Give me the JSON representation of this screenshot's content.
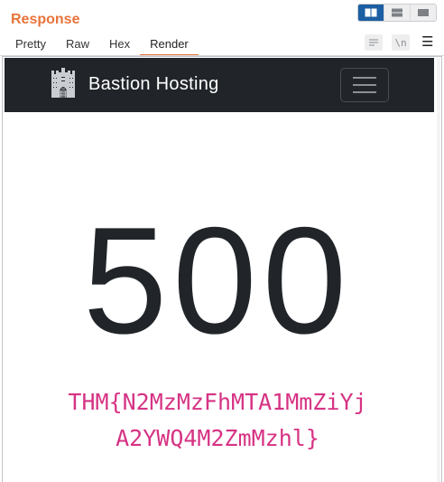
{
  "panel": {
    "title": "Response"
  },
  "layout_toggles": [
    {
      "icon": "split-view-icon",
      "active": true
    },
    {
      "icon": "horizontal-view-icon",
      "active": false
    },
    {
      "icon": "single-view-icon",
      "active": false
    }
  ],
  "tabs": [
    {
      "label": "Pretty",
      "active": false
    },
    {
      "label": "Raw",
      "active": false
    },
    {
      "label": "Hex",
      "active": false
    },
    {
      "label": "Render",
      "active": true
    }
  ],
  "tools": {
    "wrap_icon": "word-wrap-icon",
    "newline_label": "\\n",
    "menu_icon": "hamburger-menu-icon"
  },
  "render": {
    "navbar": {
      "brand_name": "Bastion Hosting",
      "logo_icon": "castle-logo-icon",
      "toggler_icon": "navbar-toggler-icon"
    },
    "error_code": "500",
    "flag_line1": "THM{N2MzMzFhMTA1MmZiYj",
    "flag_line2": "A2YWQ4M2ZmMzhl}"
  },
  "colors": {
    "accent": "#e8743b",
    "active_toggle": "#1c5ea3",
    "navbar_bg": "#212529",
    "flag_text": "#d63384"
  }
}
